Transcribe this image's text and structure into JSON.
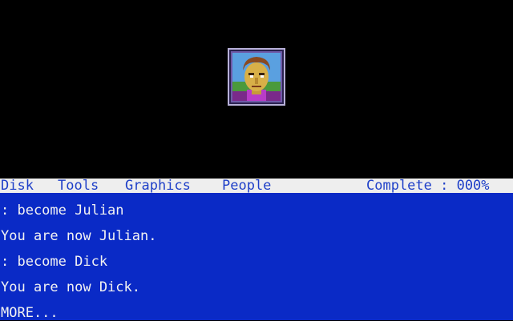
{
  "portrait": {
    "character": "Julian",
    "icon": "character-portrait"
  },
  "menu": {
    "items": [
      "Disk",
      "Tools",
      "Graphics",
      "People"
    ],
    "status": "Complete : 000%"
  },
  "console": {
    "lines": [
      ": become Julian",
      "You are now Julian.",
      ": become Dick",
      "You are now Dick.",
      "MORE..."
    ]
  },
  "colors": {
    "menu_bg": "#eeeeee",
    "menu_text": "#1e3fc8",
    "console_bg": "#0a2ac6",
    "console_text": "#f2f2f2",
    "frame": "#6e5aa8"
  }
}
